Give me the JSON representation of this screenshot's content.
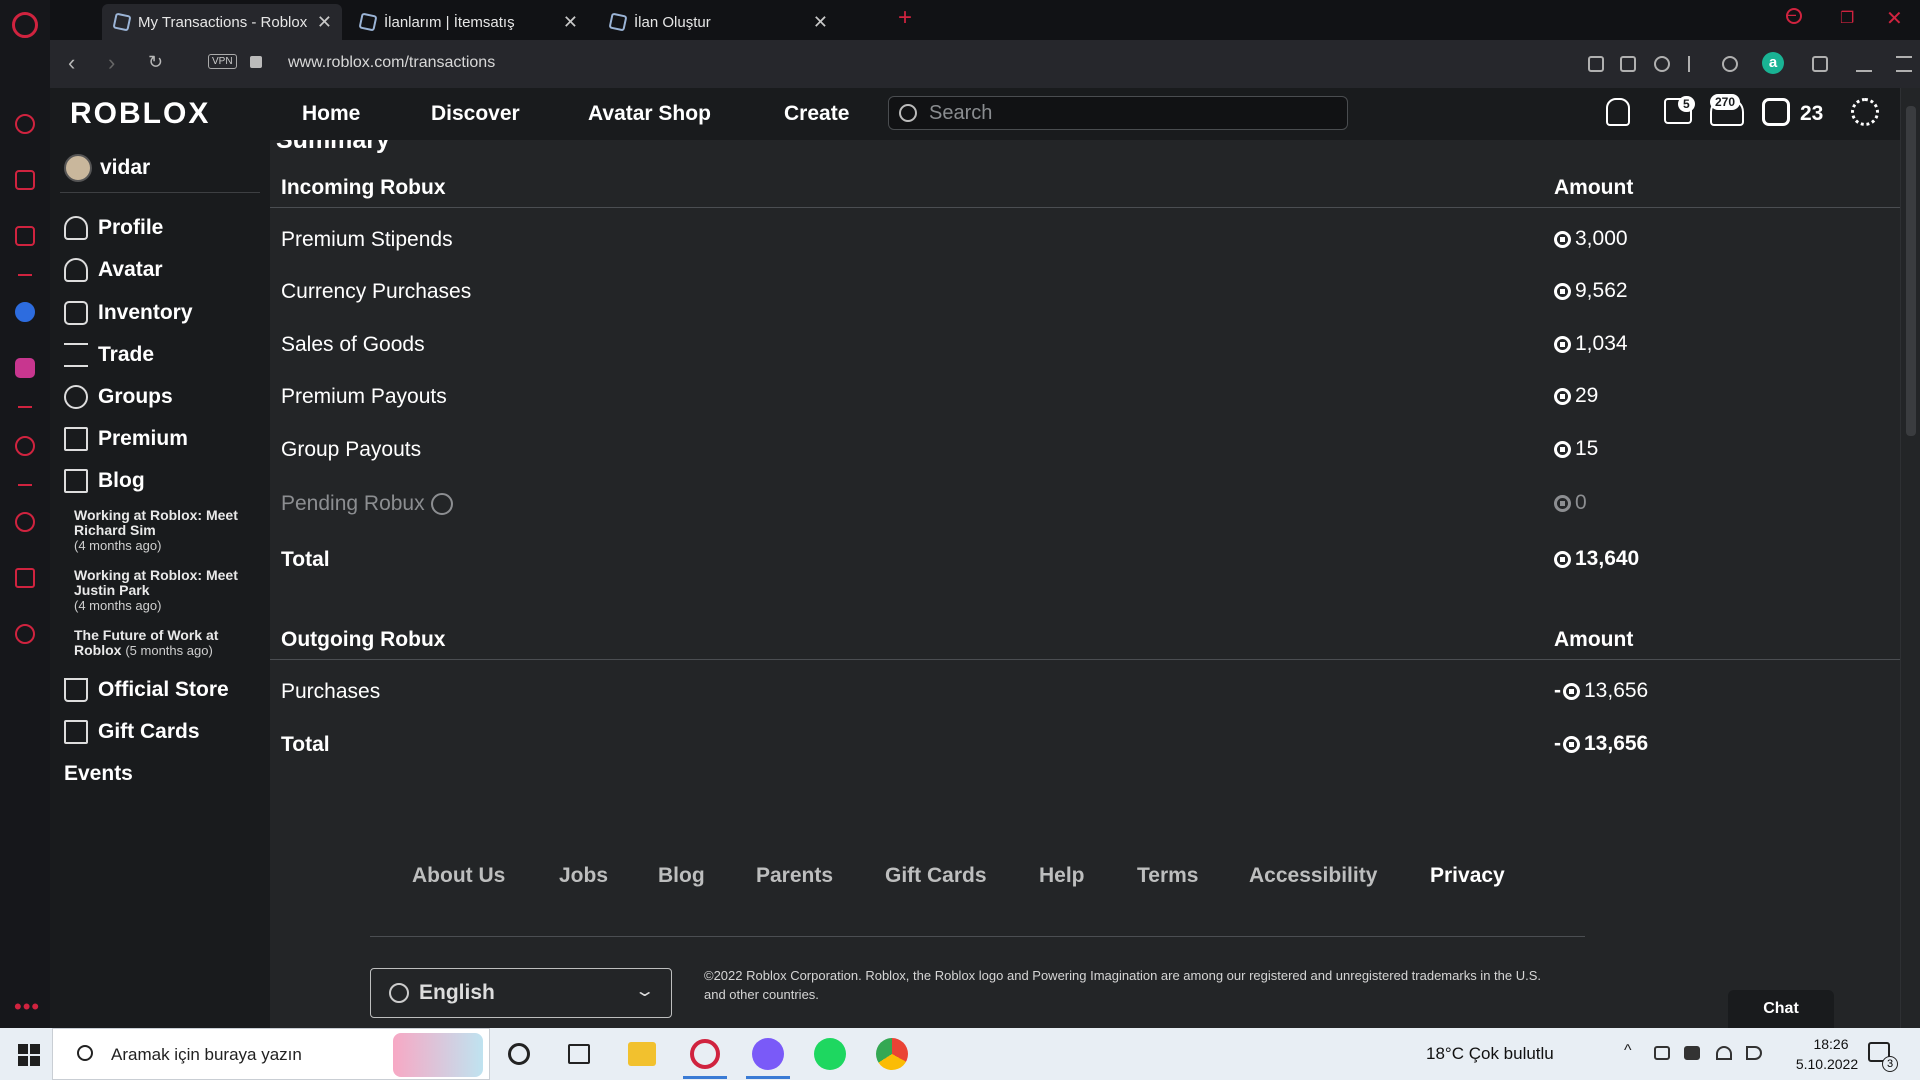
{
  "browser": {
    "tabs": [
      {
        "label": "My Transactions - Roblox"
      },
      {
        "label": "İlanlarım | İtemsatış"
      },
      {
        "label": "İlan Oluştur"
      }
    ],
    "new_tab": "+",
    "url": "www.roblox.com/transactions",
    "vpn": "VPN",
    "extension_letter": "a"
  },
  "header": {
    "logo": "ROBLOX",
    "nav": [
      "Home",
      "Discover",
      "Avatar Shop",
      "Create"
    ],
    "search_placeholder": "Search",
    "messages_badge": "5",
    "friends_badge": "270",
    "robux_count": "23"
  },
  "sidebar": {
    "username": "vidar",
    "items": [
      "Profile",
      "Avatar",
      "Inventory",
      "Trade",
      "Groups",
      "Premium",
      "Blog"
    ],
    "blog_posts": [
      {
        "title": "Working at Roblox: Meet Richard Sim",
        "ago": "(4 months ago)"
      },
      {
        "title": "Working at Roblox: Meet Justin Park",
        "ago": "(4 months ago)"
      },
      {
        "title": "The Future of Work at Roblox",
        "ago": "(5 months ago)"
      }
    ],
    "bottom_items": [
      "Official Store",
      "Gift Cards"
    ],
    "events": "Events"
  },
  "summary": {
    "title": "Summary",
    "incoming": {
      "header": "Incoming Robux",
      "amount_header": "Amount",
      "rows": [
        {
          "label": "Premium Stipends",
          "amount": "3,000"
        },
        {
          "label": "Currency Purchases",
          "amount": "9,562"
        },
        {
          "label": "Sales of Goods",
          "amount": "1,034"
        },
        {
          "label": "Premium Payouts",
          "amount": "29"
        },
        {
          "label": "Group Payouts",
          "amount": "15"
        }
      ],
      "pending_label": "Pending Robux",
      "pending_amount": "0",
      "total_label": "Total",
      "total_amount": "13,640"
    },
    "outgoing": {
      "header": "Outgoing Robux",
      "amount_header": "Amount",
      "purchases_label": "Purchases",
      "purchases_amount": "13,656",
      "total_label": "Total",
      "total_amount": "13,656",
      "sign": "-"
    }
  },
  "footer": {
    "links": [
      "About Us",
      "Jobs",
      "Blog",
      "Parents",
      "Gift Cards",
      "Help",
      "Terms",
      "Accessibility",
      "Privacy"
    ],
    "language": "English",
    "copyright": "©2022 Roblox Corporation. Roblox, the Roblox logo and Powering Imagination are among our registered and unregistered trademarks in the U.S. and other countries.",
    "chat": "Chat"
  },
  "taskbar": {
    "search_placeholder": "Aramak için buraya yazın",
    "weather": "18°C  Çok bulutlu",
    "time": "18:26",
    "date": "5.10.2022",
    "notifications": "3"
  }
}
